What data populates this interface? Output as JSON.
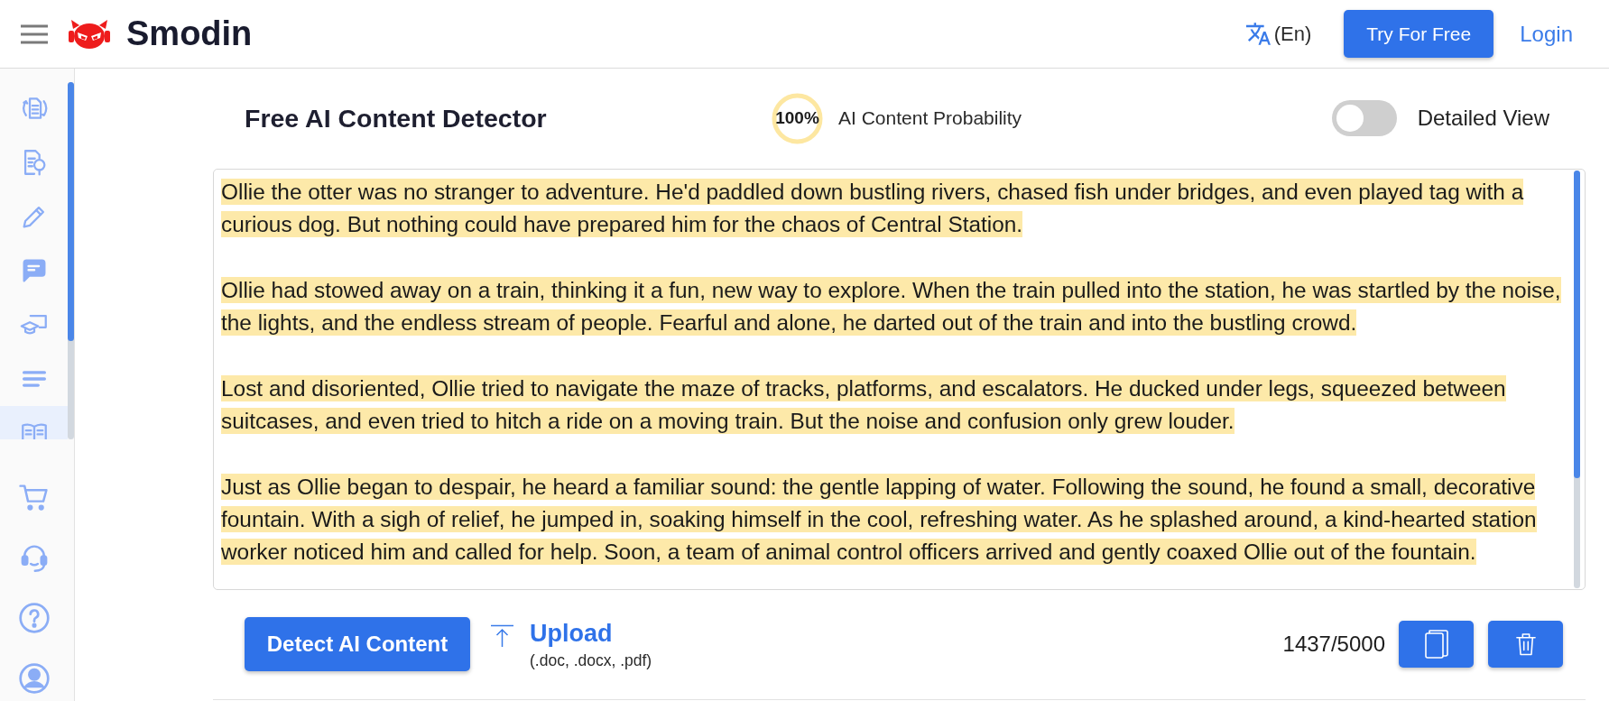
{
  "header": {
    "brand": "Smodin",
    "language": "(En)",
    "try_button": "Try For Free",
    "login_link": "Login"
  },
  "sidebar": {
    "items": [
      {
        "selected": false
      },
      {
        "selected": false
      },
      {
        "selected": false
      },
      {
        "selected": false
      },
      {
        "selected": false
      },
      {
        "selected": false
      },
      {
        "selected": true
      }
    ]
  },
  "detector": {
    "title": "Free AI Content Detector",
    "probability": {
      "value": "100%",
      "label": "AI Content Probability",
      "level": 1
    },
    "detailed_view": {
      "label": "Detailed View",
      "on": false
    }
  },
  "editor": {
    "paragraphs": [
      {
        "text": "Ollie the otter was no stranger to adventure. He'd paddled down bustling rivers, chased fish under bridges, and even played tag with a curious dog. But nothing could have prepared him for the chaos of Central Station.",
        "highlighted": true
      },
      {
        "text": "Ollie had stowed away on a train, thinking it a fun, new way to explore. When the train pulled into the station, he was startled by the noise, the lights, and the endless stream of people. Fearful and alone, he darted out of the train and into the bustling crowd.",
        "highlighted": true
      },
      {
        "text": "Lost and disoriented, Ollie tried to navigate the maze of tracks, platforms, and escalators. He ducked under legs, squeezed between suitcases, and even tried to hitch a ride on a moving train. But the noise and confusion only grew louder.",
        "highlighted": true
      },
      {
        "text": "Just as Ollie began to despair, he heard a familiar sound: the gentle lapping of water. Following the sound, he found a small, decorative fountain. With a sigh of relief, he jumped in, soaking himself in the cool, refreshing water. As he splashed around, a kind-hearted station worker noticed him and called for help. Soon, a team of animal control officers arrived and gently coaxed Ollie out of the fountain.",
        "highlighted": true
      }
    ]
  },
  "actions": {
    "detect_button": "Detect AI Content",
    "upload": {
      "label": "Upload",
      "formats": "(.doc, .docx, .pdf)"
    },
    "char_count": "1437/5000"
  }
}
